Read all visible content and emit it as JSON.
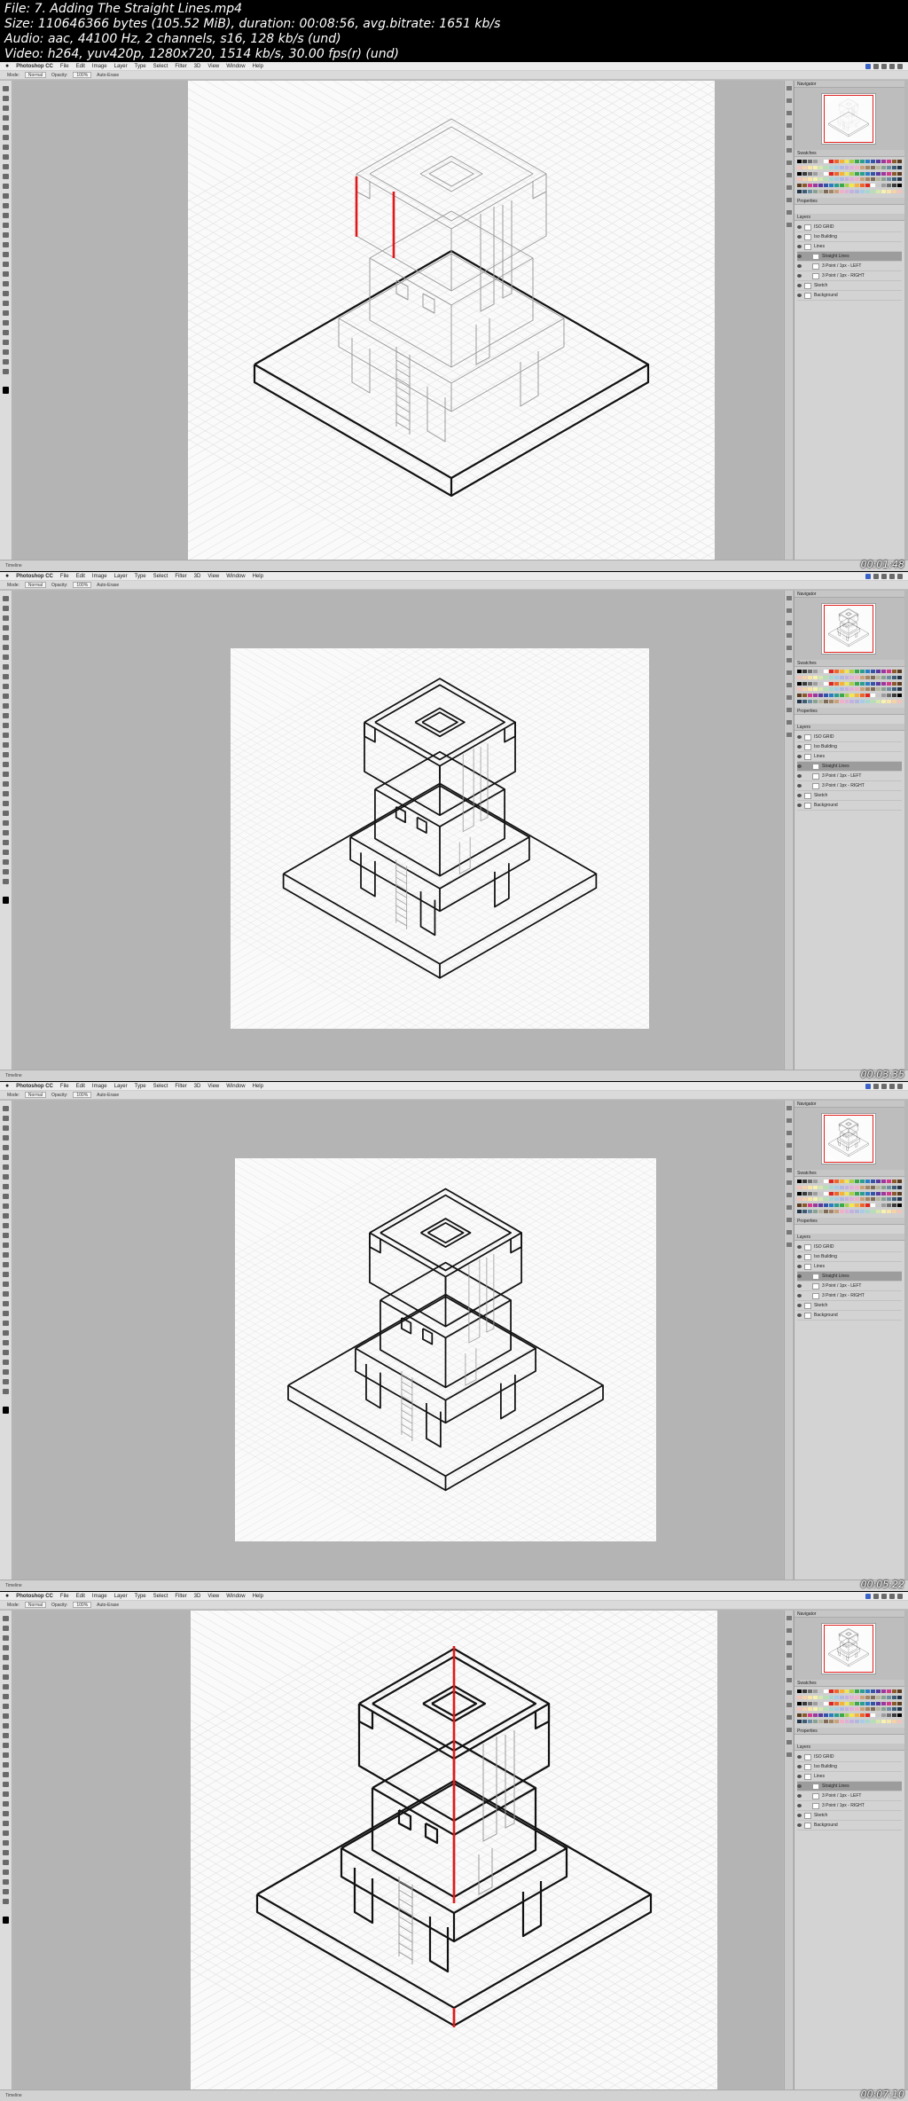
{
  "header": {
    "lines": [
      "File: 7. Adding The Straight Lines.mp4",
      "Size: 110646366 bytes (105.52 MiB), duration: 00:08:56, avg.bitrate: 1651 kb/s",
      "Audio: aac, 44100 Hz, 2 channels, s16, 128 kb/s (und)",
      "Video: h264, yuv420p, 1280x720, 1514 kb/s, 30.00 fps(r) (und)"
    ]
  },
  "app": {
    "apple": "",
    "name": "Photoshop CC",
    "menu": [
      "File",
      "Edit",
      "Image",
      "Layer",
      "Type",
      "Select",
      "Filter",
      "3D",
      "View",
      "Window",
      "Help"
    ]
  },
  "options_bar": [
    "Mode:",
    "Normal",
    "Opacity:",
    "100%",
    "Auto-Erase"
  ],
  "panels": {
    "navigator_tab": "Navigator",
    "swatches_tab": "Swatches",
    "properties_tab": "Properties",
    "layers_tab": "Layers",
    "layers": [
      {
        "name": "ISO GRID",
        "selected": false
      },
      {
        "name": "Iso Building",
        "selected": false
      },
      {
        "name": "Lines",
        "selected": false
      },
      {
        "name": "Straight Lines",
        "selected": true
      },
      {
        "name": "3 Point / 1px - LEFT",
        "selected": false
      },
      {
        "name": "3 Point / 1px - RIGHT",
        "selected": false
      },
      {
        "name": "Sketch",
        "selected": false
      },
      {
        "name": "Background",
        "selected": false
      }
    ],
    "swatch_colors": [
      "#000000",
      "#3a3a3a",
      "#6e6e6e",
      "#9c9c9c",
      "#c8c8c8",
      "#ffffff",
      "#e0261f",
      "#f0632a",
      "#f6b33a",
      "#f4e64b",
      "#a6d14a",
      "#38a84a",
      "#2a9d8f",
      "#2a7fc4",
      "#3453a8",
      "#5b3a9e",
      "#9b3a9e",
      "#d33a8c",
      "#8b5a2b",
      "#5a3a1e"
    ],
    "swatch_colors_2": [
      "#f5c2b8",
      "#f7d1a8",
      "#f9e6a8",
      "#f7f2b0",
      "#d4e8b0",
      "#b6dfb4",
      "#a6d8d0",
      "#a8cbe8",
      "#b0b8e0",
      "#c6b0e0",
      "#e0b0d8",
      "#f0b0c8",
      "#c9a27a",
      "#a38464",
      "#7d6a57",
      "#b5b5a0",
      "#8aa092",
      "#6c8ea3",
      "#3e5c76",
      "#1f3247"
    ]
  },
  "frames": [
    {
      "timestamp": "00:01:48"
    },
    {
      "timestamp": "00:03:35"
    },
    {
      "timestamp": "00:05:22"
    },
    {
      "timestamp": "00:07:10"
    }
  ],
  "status_text": "Timeline"
}
